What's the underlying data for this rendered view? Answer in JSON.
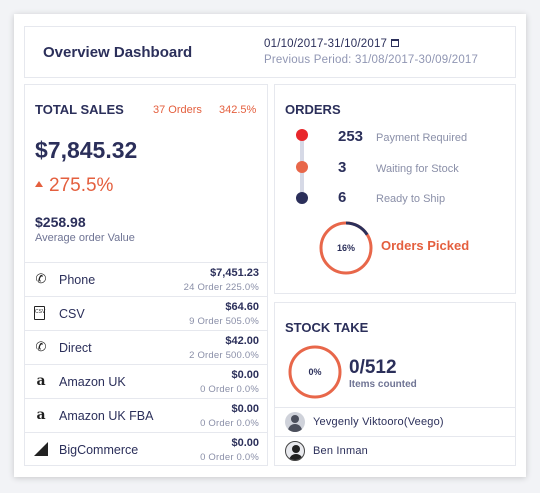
{
  "header": {
    "title": "Overview Dashboard",
    "date_range": "01/10/2017-31/10/2017",
    "previous_period": "Previous Period: 31/08/2017-30/09/2017"
  },
  "total_sales": {
    "label": "TOTAL SALES",
    "orders": "37 Orders",
    "percent": "342.5%",
    "amount": "$7,845.32",
    "growth": "275.5%",
    "average_value": "$258.98",
    "average_label": "Average order Value"
  },
  "channels": [
    {
      "name": "Phone",
      "amount": "$7,451.23",
      "detail": "24 Order  225.0%",
      "icon": "phone-icon"
    },
    {
      "name": "CSV",
      "amount": "$64.60",
      "detail": "9 Order  505.0%",
      "icon": "csv-file-icon"
    },
    {
      "name": "Direct",
      "amount": "$42.00",
      "detail": "2 Order  500.0%",
      "icon": "phone-icon"
    },
    {
      "name": "Amazon UK",
      "amount": "$0.00",
      "detail": "0 Order  0.0%",
      "icon": "amazon-icon"
    },
    {
      "name": "Amazon UK FBA",
      "amount": "$0.00",
      "detail": "0 Order  0.0%",
      "icon": "amazon-icon"
    },
    {
      "name": "BigCommerce",
      "amount": "$0.00",
      "detail": "0 Order  0.0%",
      "icon": "bigcommerce-icon"
    }
  ],
  "orders": {
    "label": "ORDERS",
    "items": [
      {
        "count": "253",
        "label": "Payment Required",
        "color": "#e8272b"
      },
      {
        "count": "3",
        "label": "Waiting for Stock",
        "color": "#e8674a"
      },
      {
        "count": "6",
        "label": "Ready to Ship",
        "color": "#2b2f5a"
      }
    ],
    "picked_percent": "16%",
    "picked_fraction": 0.16,
    "picked_label": "Orders Picked"
  },
  "stock_take": {
    "label": "STOCK TAKE",
    "percent": "0%",
    "count": "0/512",
    "count_label": "Items counted",
    "users": [
      "Yevgenly Viktooro(Veego)",
      "Ben Inman"
    ]
  },
  "colors": {
    "accent": "#e45f3e",
    "navy": "#2b2f5a",
    "ring_track": "#e8674a"
  }
}
